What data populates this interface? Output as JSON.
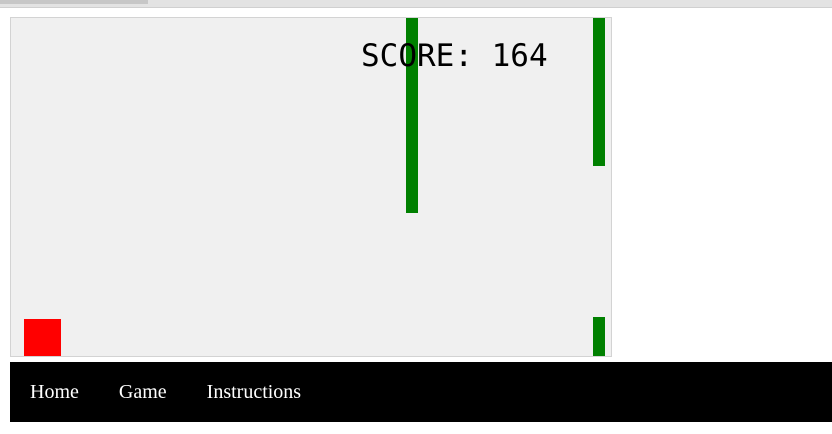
{
  "game": {
    "score_label": "SCORE: 164",
    "colors": {
      "canvas_background": "#f0f0f0",
      "obstacle": "#008000",
      "player": "#ff0000"
    }
  },
  "nav": {
    "items": [
      {
        "label": "Home"
      },
      {
        "label": "Game"
      },
      {
        "label": "Instructions"
      }
    ],
    "colors": {
      "background": "#000000",
      "text": "#ffffff"
    }
  }
}
